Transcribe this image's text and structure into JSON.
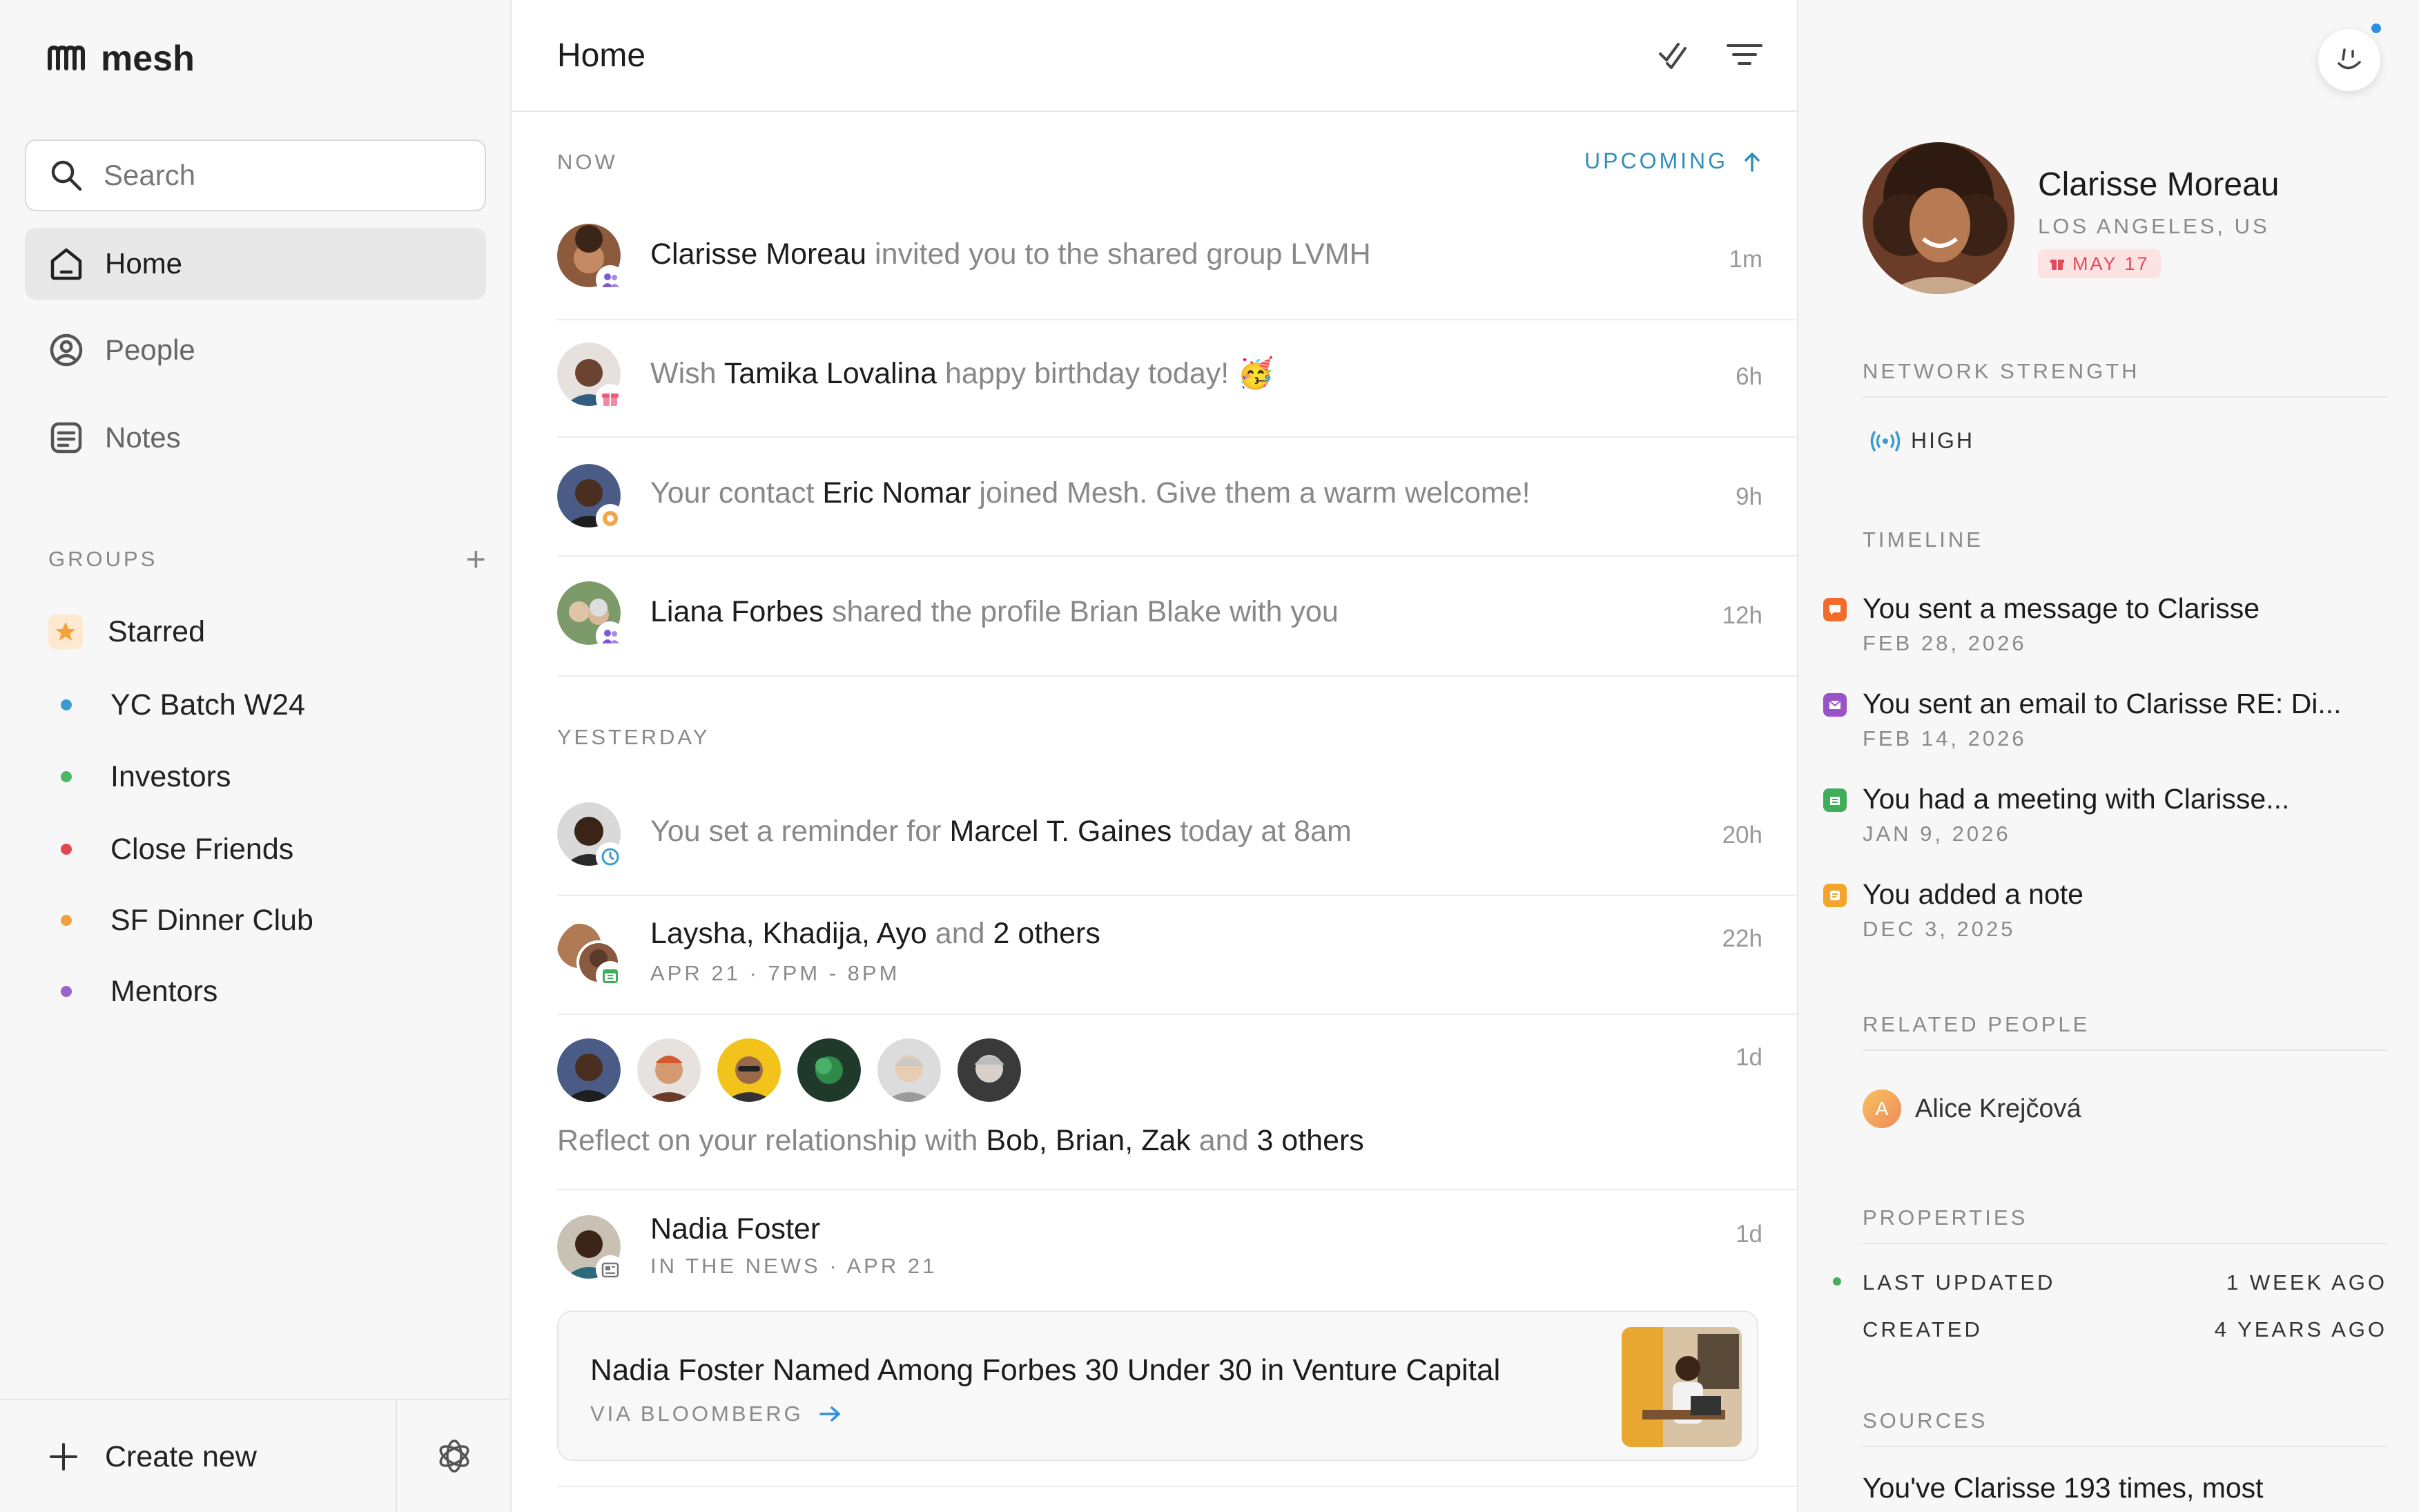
{
  "app": {
    "logo_text": "mesh"
  },
  "sidebar": {
    "search_placeholder": "Search",
    "nav": [
      {
        "label": "Home",
        "icon": "home-icon",
        "active": true
      },
      {
        "label": "People",
        "icon": "person-circle-icon",
        "active": false
      },
      {
        "label": "Notes",
        "icon": "notes-icon",
        "active": false
      }
    ],
    "groups_title": "GROUPS",
    "groups": [
      {
        "label": "Starred",
        "color": "#f4a23a"
      },
      {
        "label": "YC Batch W24",
        "color": "#3b9bd1"
      },
      {
        "label": "Investors",
        "color": "#4cb864"
      },
      {
        "label": "Close Friends",
        "color": "#e4474f"
      },
      {
        "label": "SF Dinner Club",
        "color": "#f0a040"
      },
      {
        "label": "Mentors",
        "color": "#9a63c9"
      }
    ],
    "create_label": "Create new"
  },
  "feed": {
    "title": "Home",
    "now_label": "NOW",
    "upcoming_label": "UPCOMING",
    "yesterday_label": "YESTERDAY",
    "items": [
      {
        "pre": "",
        "name": "Clarisse Moreau",
        "post": " invited you to the shared group LVMH",
        "time": "1m"
      },
      {
        "pre": "Wish ",
        "name": "Tamika Lovalina",
        "post": " happy birthday today! 🥳",
        "time": "6h"
      },
      {
        "pre": "Your contact ",
        "name": "Eric Nomar",
        "post": " joined Mesh. Give them a warm welcome!",
        "time": "9h"
      },
      {
        "pre": "",
        "name": "Liana Forbes",
        "post": " shared the profile Brian Blake with you",
        "time": "12h"
      },
      {
        "pre": "You set a reminder for ",
        "name": "Marcel T. Gaines",
        "post": " today at 8am",
        "time": "20h"
      },
      {
        "pre": "",
        "name": "Laysha, Khadija, Ayo",
        "post": " and ",
        "extra": "2 others",
        "subline": "APR 21 · 7PM - 8PM",
        "time": "22h"
      },
      {
        "pre": "Reflect on your relationship with ",
        "name": "Bob, Brian, Zak",
        "post": " and ",
        "extra": "3 others",
        "time": "1d"
      },
      {
        "name": "Nadia Foster",
        "subline": "IN THE NEWS · APR 21",
        "time": "1d"
      }
    ],
    "news": {
      "title": "Nadia Foster Named Among Forbes 30 Under 30 in Venture Capital",
      "via": "VIA BLOOMBERG"
    }
  },
  "details": {
    "name": "Clarisse Moreau",
    "location": "LOS ANGELES, US",
    "birthday": "MAY 17",
    "network_title": "NETWORK STRENGTH",
    "network_value": "HIGH",
    "timeline_title": "TIMELINE",
    "timeline": [
      {
        "text": "You sent a message to Clarisse",
        "date": "FEB 28, 2026",
        "color": "#f26b2a",
        "icon": "message-icon"
      },
      {
        "text": "You sent an email to Clarisse RE: Di...",
        "date": "FEB 14, 2026",
        "color": "#9a52c9",
        "icon": "email-icon"
      },
      {
        "text": "You had a meeting with Clarisse...",
        "date": "JAN 9, 2026",
        "color": "#3fae5a",
        "icon": "calendar-icon"
      },
      {
        "text": "You added a note",
        "date": "DEC 3, 2025",
        "color": "#f2a52a",
        "icon": "note-icon"
      }
    ],
    "related_title": "RELATED PEOPLE",
    "related": [
      {
        "name": "Alice Krejčová",
        "initial": "A"
      }
    ],
    "properties_title": "PROPERTIES",
    "properties": [
      {
        "label": "LAST UPDATED",
        "value": "1 WEEK AGO"
      },
      {
        "label": "CREATED",
        "value": "4 YEARS AGO"
      }
    ],
    "sources_title": "SOURCES",
    "sources_text": "You've Clarisse 193 times, most"
  }
}
